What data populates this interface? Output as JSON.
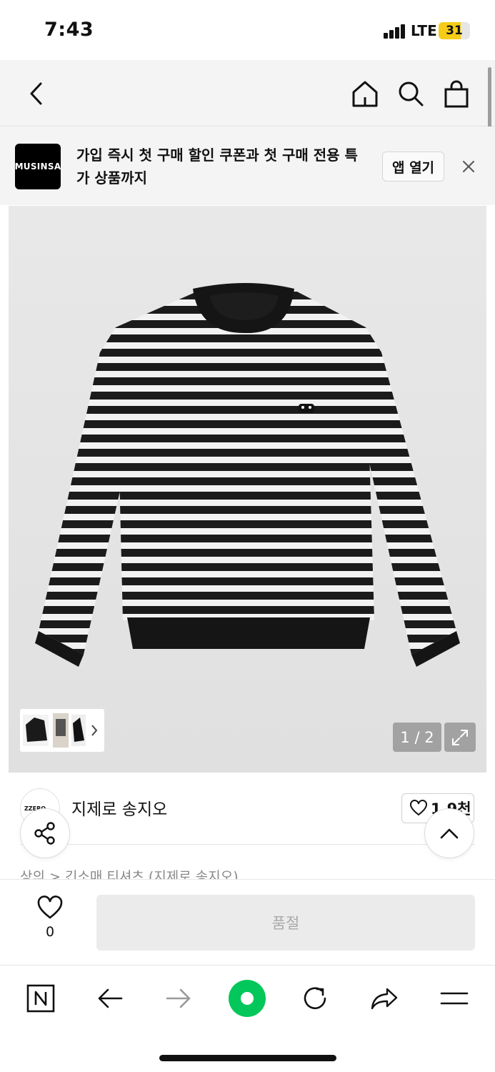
{
  "status_bar": {
    "time": "7:43",
    "network": "LTE",
    "battery_level": "31",
    "battery_fill_percent": 70,
    "battery_color": "#f5cc18"
  },
  "nav": {
    "icons": [
      "chevron-left-icon",
      "home-icon",
      "search-icon",
      "shopping-bag-icon"
    ]
  },
  "banner": {
    "logo_text": "MUSINSA",
    "message": "가입 즉시 첫 구매 할인 쿠폰과 첫 구매 전용 특가 상품까지",
    "open_app_label": "앱 열기"
  },
  "gallery": {
    "counter": "1 / 2",
    "background": "#e4e4e4"
  },
  "brand": {
    "avatar_text": "ZZERO",
    "name": "지제로 송지오",
    "likes": "1.9천"
  },
  "breadcrumb": {
    "text": "상의 > 긴소매 티셔츠 (지제로 송지오)"
  },
  "purchase": {
    "wish_count": "0",
    "soldout_label": "품절"
  },
  "toolbar": {
    "icons": [
      "naver-n-icon",
      "back-arrow-icon",
      "forward-arrow-icon",
      "green-circle-icon",
      "reload-icon",
      "share-icon",
      "menu-icon"
    ],
    "accent": "#03c75a"
  }
}
